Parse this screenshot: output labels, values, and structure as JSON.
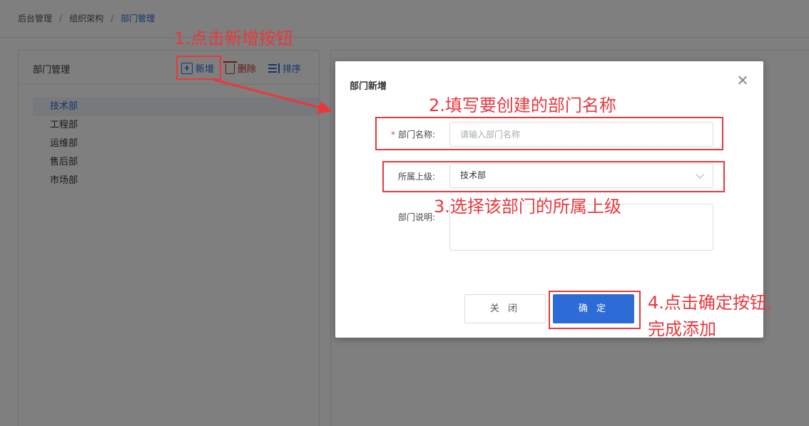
{
  "breadcrumb": [
    "后台管理",
    "组织架构",
    "部门管理"
  ],
  "left_panel": {
    "title": "部门管理",
    "toolbar": {
      "add": "新增",
      "delete": "删除",
      "sort": "排序"
    },
    "departments": [
      "技术部",
      "工程部",
      "运维部",
      "售后部",
      "市场部"
    ],
    "selected": "技术部"
  },
  "modal": {
    "title": "部门新增",
    "fields": {
      "name_label": "部门名称:",
      "name_placeholder": "请输入部门名称",
      "parent_label": "所属上级:",
      "parent_value": "技术部",
      "desc_label": "部门说明:"
    },
    "buttons": {
      "close": "关 闭",
      "ok": "确 定"
    }
  },
  "annotations": {
    "step1": "1.点击新增按钮",
    "step2": "2.填写要创建的部门名称",
    "step3": "3.选择该部门的所属上级",
    "step4_line1": "4.点击确定按钮,",
    "step4_line2": "完成添加"
  },
  "colors": {
    "accent": "#2d6bd6",
    "annotation": "#e8383d",
    "danger": "#c0392b"
  }
}
